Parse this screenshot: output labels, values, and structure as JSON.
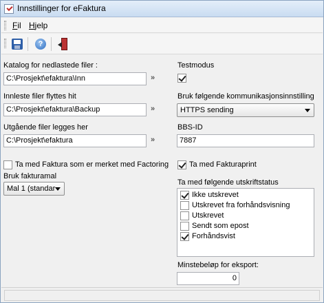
{
  "window": {
    "title": "Innstillinger for eFaktura"
  },
  "menu": {
    "items": [
      "Fil",
      "Hjelp"
    ]
  },
  "toolbar": {
    "icons": [
      "save-icon",
      "help-icon",
      "exit-icon"
    ]
  },
  "left": {
    "download_dir": {
      "label": "Katalog for nedlastede filer :",
      "value": "C:\\Prosjekt\\efaktura\\Inn"
    },
    "read_dir": {
      "label": "Innleste filer flyttes hit",
      "value": "C:\\Prosjekt\\efaktura\\Backup"
    },
    "outgoing_dir": {
      "label": "Utgående filer legges her",
      "value": "C:\\Prosjekt\\efaktura"
    },
    "browse_glyph": "»",
    "factoring": {
      "label": "Ta med Faktura som er merket med Factoring",
      "checked": false
    },
    "template": {
      "label": "Bruk fakturamal",
      "selected": "Mal 1 (standar"
    }
  },
  "right": {
    "testmode": {
      "label": "Testmodus",
      "checked": true
    },
    "comm": {
      "label": "Bruk følgende kommunikasjonsinnstilling",
      "selected": "HTTPS sending"
    },
    "bbs": {
      "label": "BBS-ID",
      "value": "7887"
    },
    "invoiceprint": {
      "label": "Ta med Fakturaprint",
      "checked": true
    },
    "printstatus": {
      "label": "Ta med følgende utskriftstatus",
      "items": [
        {
          "label": "Ikke utskrevet",
          "checked": true
        },
        {
          "label": "Utskrevet fra forhåndsvisning",
          "checked": false
        },
        {
          "label": "Utskrevet",
          "checked": false
        },
        {
          "label": "Sendt som epost",
          "checked": false
        },
        {
          "label": "Forhåndsvist",
          "checked": true
        }
      ]
    },
    "minamount": {
      "label": "Minstebeløp for eksport:",
      "value": "0"
    }
  }
}
